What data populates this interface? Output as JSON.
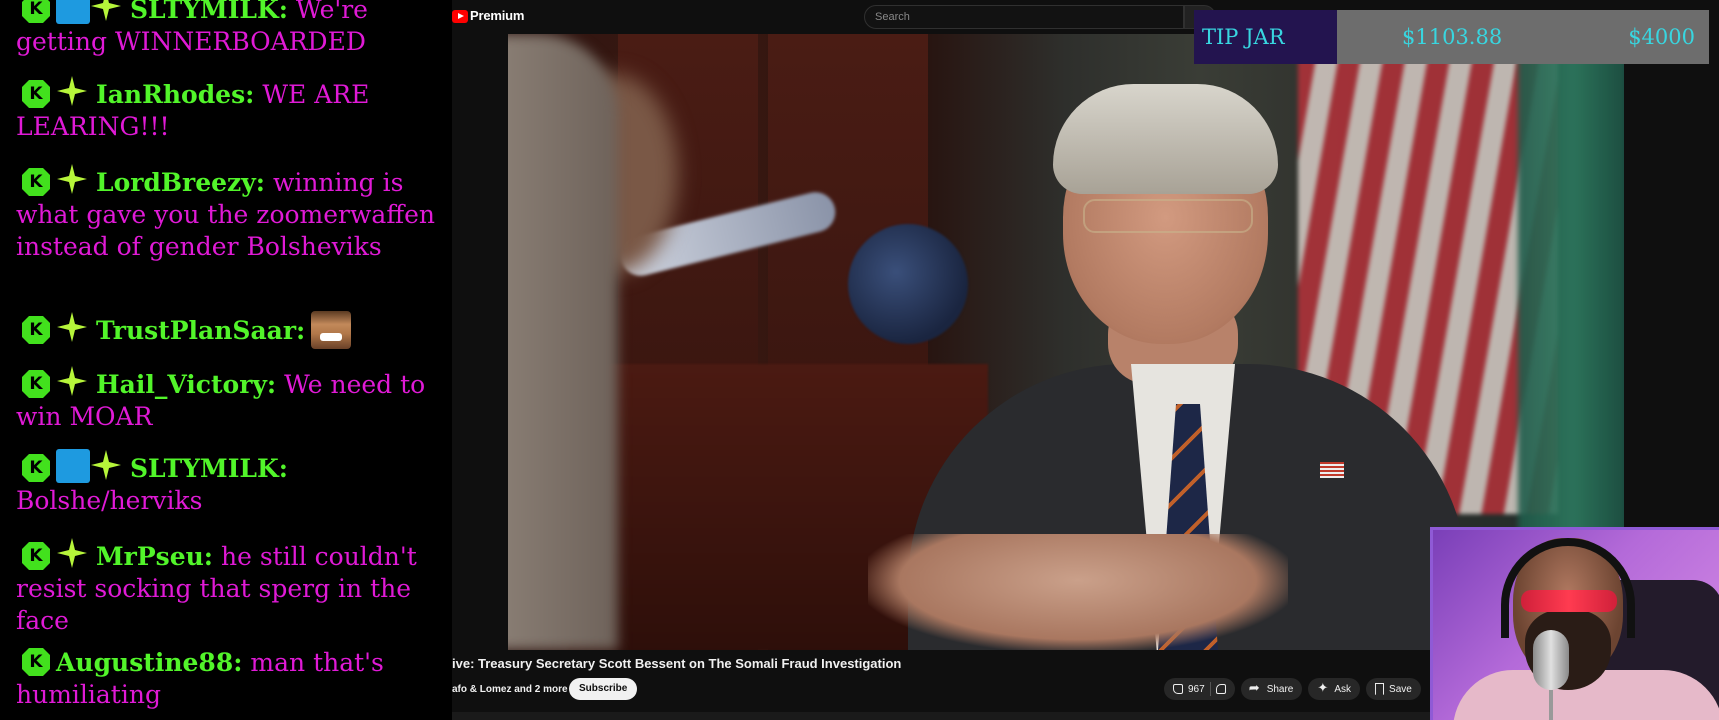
{
  "chat": {
    "messages": [
      {
        "username": "SLTYMILK:",
        "text": "We're getting WINNERBOARDED",
        "badges": [
          "k-badge",
          "gavel-badge",
          "sparkle-badge"
        ]
      },
      {
        "username": "IanRhodes:",
        "text": "WE ARE LEARING!!!",
        "badges": [
          "k-badge",
          "sparkle-badge"
        ]
      },
      {
        "username": "LordBreezy:",
        "text": "winning is what gave you the zoomerwaffen instead of gender Bolsheviks",
        "badges": [
          "k-badge",
          "sparkle-badge"
        ]
      },
      {
        "username": "TrustPlanSaar:",
        "text": "",
        "badges": [
          "k-badge",
          "sparkle-badge"
        ],
        "emote": "laughing-face-emote"
      },
      {
        "username": "Hail_Victory:",
        "text": "We need to win MOAR",
        "badges": [
          "k-badge",
          "sparkle-badge"
        ]
      },
      {
        "username": "SLTYMILK:",
        "text": "Bolshe/herviks",
        "badges": [
          "k-badge",
          "gavel-badge",
          "sparkle-badge"
        ]
      },
      {
        "username": "MrPseu:",
        "text": "he still couldn't resist socking that sperg in the face",
        "badges": [
          "k-badge",
          "sparkle-badge"
        ]
      },
      {
        "username": "Augustine88:",
        "text": "man that's humiliating",
        "badges": [
          "k-badge"
        ]
      }
    ],
    "colors": {
      "username": "#52f52a",
      "message": "#e01ad6",
      "badge": "#42e11d",
      "gavel": "#1e9ae0"
    }
  },
  "youtube": {
    "brand": "Premium",
    "search_placeholder": "Search",
    "video_title": "ive: Treasury Secretary Scott Bessent on The Somali Fraud Investigation",
    "channel": "afo & Lomez and 2 more",
    "subscribe_label": "Subscribe",
    "likes": "967",
    "share_label": "Share",
    "ask_label": "Ask",
    "save_label": "Save"
  },
  "tip_jar": {
    "label": "TIP JAR",
    "current": "$1103.88",
    "goal": "$4000",
    "progress": 0.276,
    "colors": {
      "label_bg": "#23144f",
      "text": "#38d6e0",
      "bar": "#6d6d6d"
    }
  },
  "webcam": {
    "border_color": "#8f5ad6"
  }
}
